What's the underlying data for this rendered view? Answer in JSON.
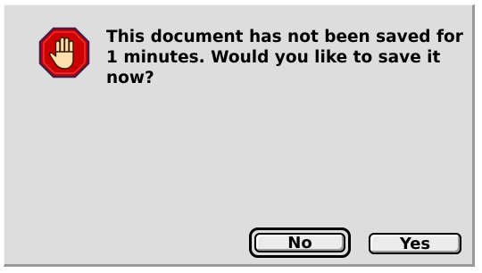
{
  "dialog": {
    "icon": "stop-hand-icon",
    "message": "This document has not been saved for 1 minutes. Would you like to save it now?",
    "buttons": {
      "no_label": "No",
      "yes_label": "Yes"
    },
    "default_button": "No"
  }
}
